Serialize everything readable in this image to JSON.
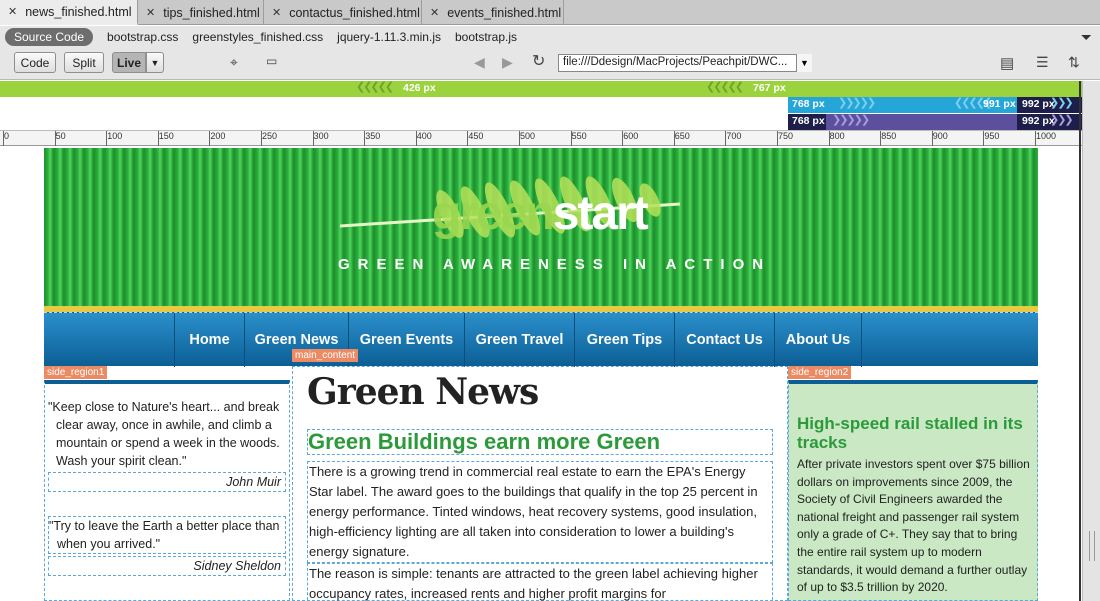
{
  "tabs": [
    {
      "label": "news_finished.html"
    },
    {
      "label": "tips_finished.html"
    },
    {
      "label": "contactus_finished.html"
    },
    {
      "label": "events_finished.html"
    }
  ],
  "related_files": {
    "source_code": "Source Code",
    "files": [
      "bootstrap.css",
      "greenstyles_finished.css",
      "jquery-1.11.3.min.js",
      "bootstrap.js"
    ]
  },
  "toolbar": {
    "code": "Code",
    "split": "Split",
    "live": "Live",
    "url": "file:///Ddesign/MacProjects/Peachpit/DWC..."
  },
  "media_queries": {
    "bar1_left": "426  px",
    "bar1_right": "767  px",
    "bar2_left": "768  px",
    "bar2_mid": "991  px",
    "bar2_right": "992  px",
    "bar3_left": "768  px",
    "bar3_right": "992  px"
  },
  "ruler": [
    "0",
    "50",
    "100",
    "150",
    "200",
    "250",
    "300",
    "350",
    "400",
    "450",
    "500",
    "550",
    "600",
    "650",
    "700",
    "750",
    "800",
    "850",
    "900",
    "950",
    "1000"
  ],
  "site": {
    "logo_green": "green",
    "logo_start": "start",
    "tagline": "GREEN AWARENESS IN ACTION",
    "nav": [
      "Home",
      "Green News",
      "Green Events",
      "Green Travel",
      "Green Tips",
      "Contact Us",
      "About Us"
    ],
    "region_tags": {
      "side1": "side_region1",
      "main": "main_content",
      "side2": "side_region2"
    },
    "quotes": [
      {
        "text": "\"Keep close to Nature's heart... and break clear away, once in awhile, and climb a mountain or spend a week in the woods. Wash your spirit clean.\"",
        "author": "John Muir"
      },
      {
        "text": "\"Try to leave the Earth a better place than when you arrived.\"",
        "author": "Sidney Sheldon"
      }
    ],
    "main": {
      "heading": "Green News",
      "article_title": "Green Buildings earn more Green",
      "para1": "There is a growing trend in commercial real estate to earn the EPA's Energy Star label. The award goes to the buildings that qualify in the top 25 percent in energy performance. Tinted windows, heat recovery systems, good insulation, high-efficiency lighting are all taken into consideration to lower a building's energy signature.",
      "para2": "The reason is simple: tenants are attracted to the green label achieving higher occupancy rates, increased rents and higher profit margins for"
    },
    "sidebar2": {
      "title": "High-speed rail stalled in its tracks",
      "text": "After private investors spent over $75 billion dollars on improvements since 2009, the Society of Civil Engineers awarded the national freight and passenger rail system only a grade of C+. They say that to bring the entire rail system up to modern standards, it would demand a further outlay of up to $3.5 trillion by 2020."
    }
  },
  "colors": {
    "green_bar": "#9bd33f",
    "blue_bar": "#26a6d6",
    "purple_bar": "#5c4f9e",
    "nav_blue": "#0c5f95",
    "header_green": "#2bb23d",
    "accent_green_text": "#2b9a3a",
    "region_tag": "#ec8a63"
  }
}
